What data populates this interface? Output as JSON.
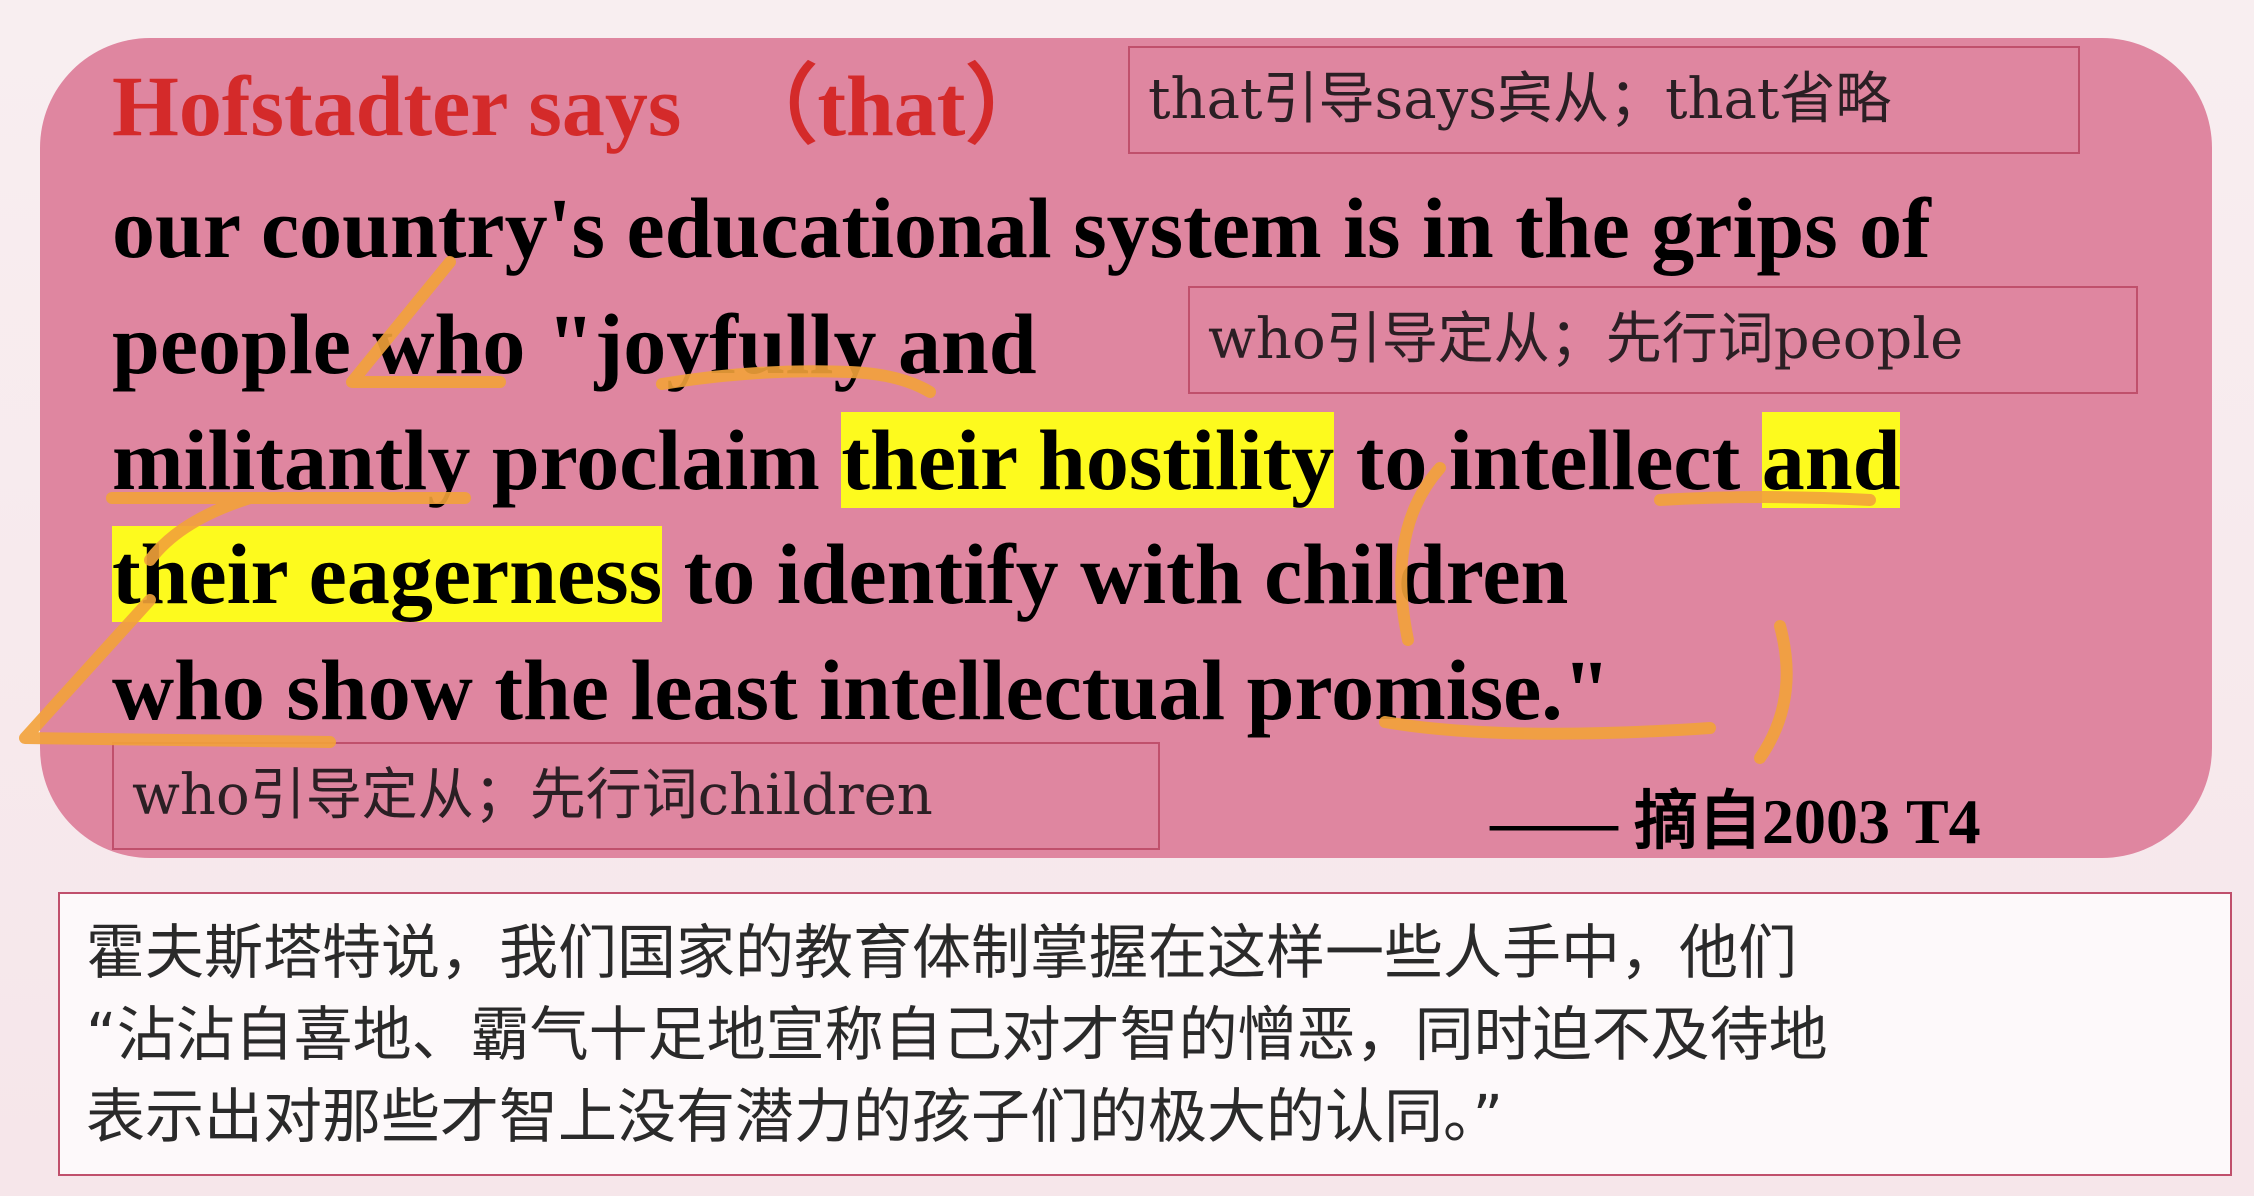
{
  "header": {
    "name_says": "Hofstadter says",
    "that_paren": "（that）"
  },
  "notes": {
    "says_clause": "that引导says宾从；that省略",
    "who_people": "who引导定从；先行词people",
    "who_children": "who引导定从；先行词children"
  },
  "sentence": {
    "line1": "our country's educational system is in the grips of",
    "line2": "people who \"joyfully and",
    "line3_a": "militantly proclaim ",
    "line3_hl1": "their hostility",
    "line3_b": " to intellect ",
    "line3_hl2": "and",
    "line4_hl": "their eagerness",
    "line4_b": " to identify with children",
    "line5": "who show the least intellectual promise.\""
  },
  "source": "—— 摘自2003 T4",
  "translation": {
    "line1": "霍夫斯塔特说，我们国家的教育体制掌握在这样一些人手中，他们",
    "line2": "“沾沾自喜地、霸气十足地宣称自己对才智的憎恶，同时迫不及待地",
    "line3": "表示出对那些才智上没有潜力的孩子们的极大的认同。”"
  },
  "colors": {
    "card": "#df86a0",
    "highlight": "#fdfa1e",
    "title_red": "#d42a2a",
    "pen": "#f2a23a"
  }
}
